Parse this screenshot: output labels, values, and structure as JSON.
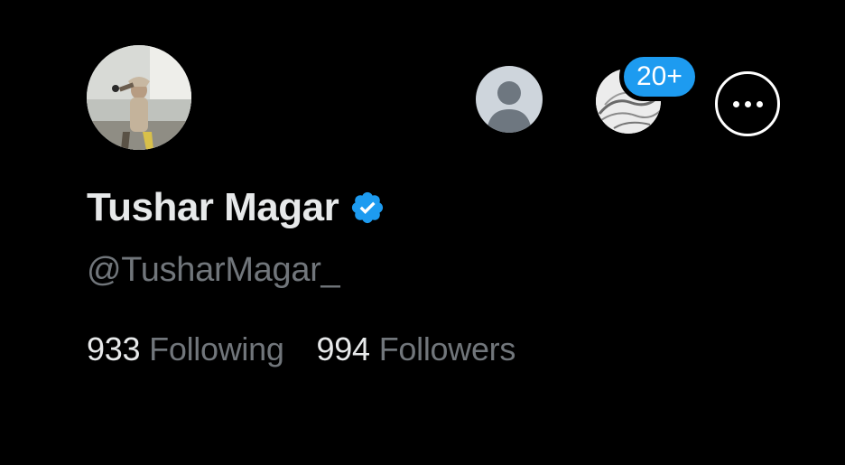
{
  "profile": {
    "display_name": "Tushar Magar",
    "handle": "@TusharMagar_",
    "verified": true,
    "following_count": "933",
    "following_label": "Following",
    "followers_count": "994",
    "followers_label": "Followers"
  },
  "header": {
    "notification_badge": "20+",
    "more_icon": "ellipsis-icon"
  },
  "colors": {
    "background": "#000000",
    "primary_text": "#e7e9ea",
    "secondary_text": "#71767b",
    "accent": "#1d9bf0"
  }
}
